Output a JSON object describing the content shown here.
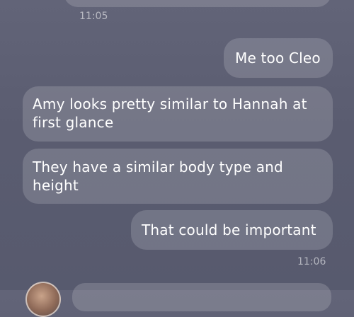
{
  "chat": {
    "timestamps": [
      "11:05",
      "11:06"
    ],
    "messages": [
      {
        "sender": "me",
        "text": "Me too Cleo"
      },
      {
        "sender": "other",
        "text": "Amy looks pretty similar to Hannah at first glance"
      },
      {
        "sender": "other",
        "text": "They have a similar body type and height"
      },
      {
        "sender": "me",
        "text": "That could be important"
      }
    ]
  },
  "colors": {
    "background": "#5e6074",
    "bubble": "rgba(255,255,255,0.16)",
    "text": "#ffffff",
    "timestamp": "rgba(255,255,255,0.55)"
  }
}
